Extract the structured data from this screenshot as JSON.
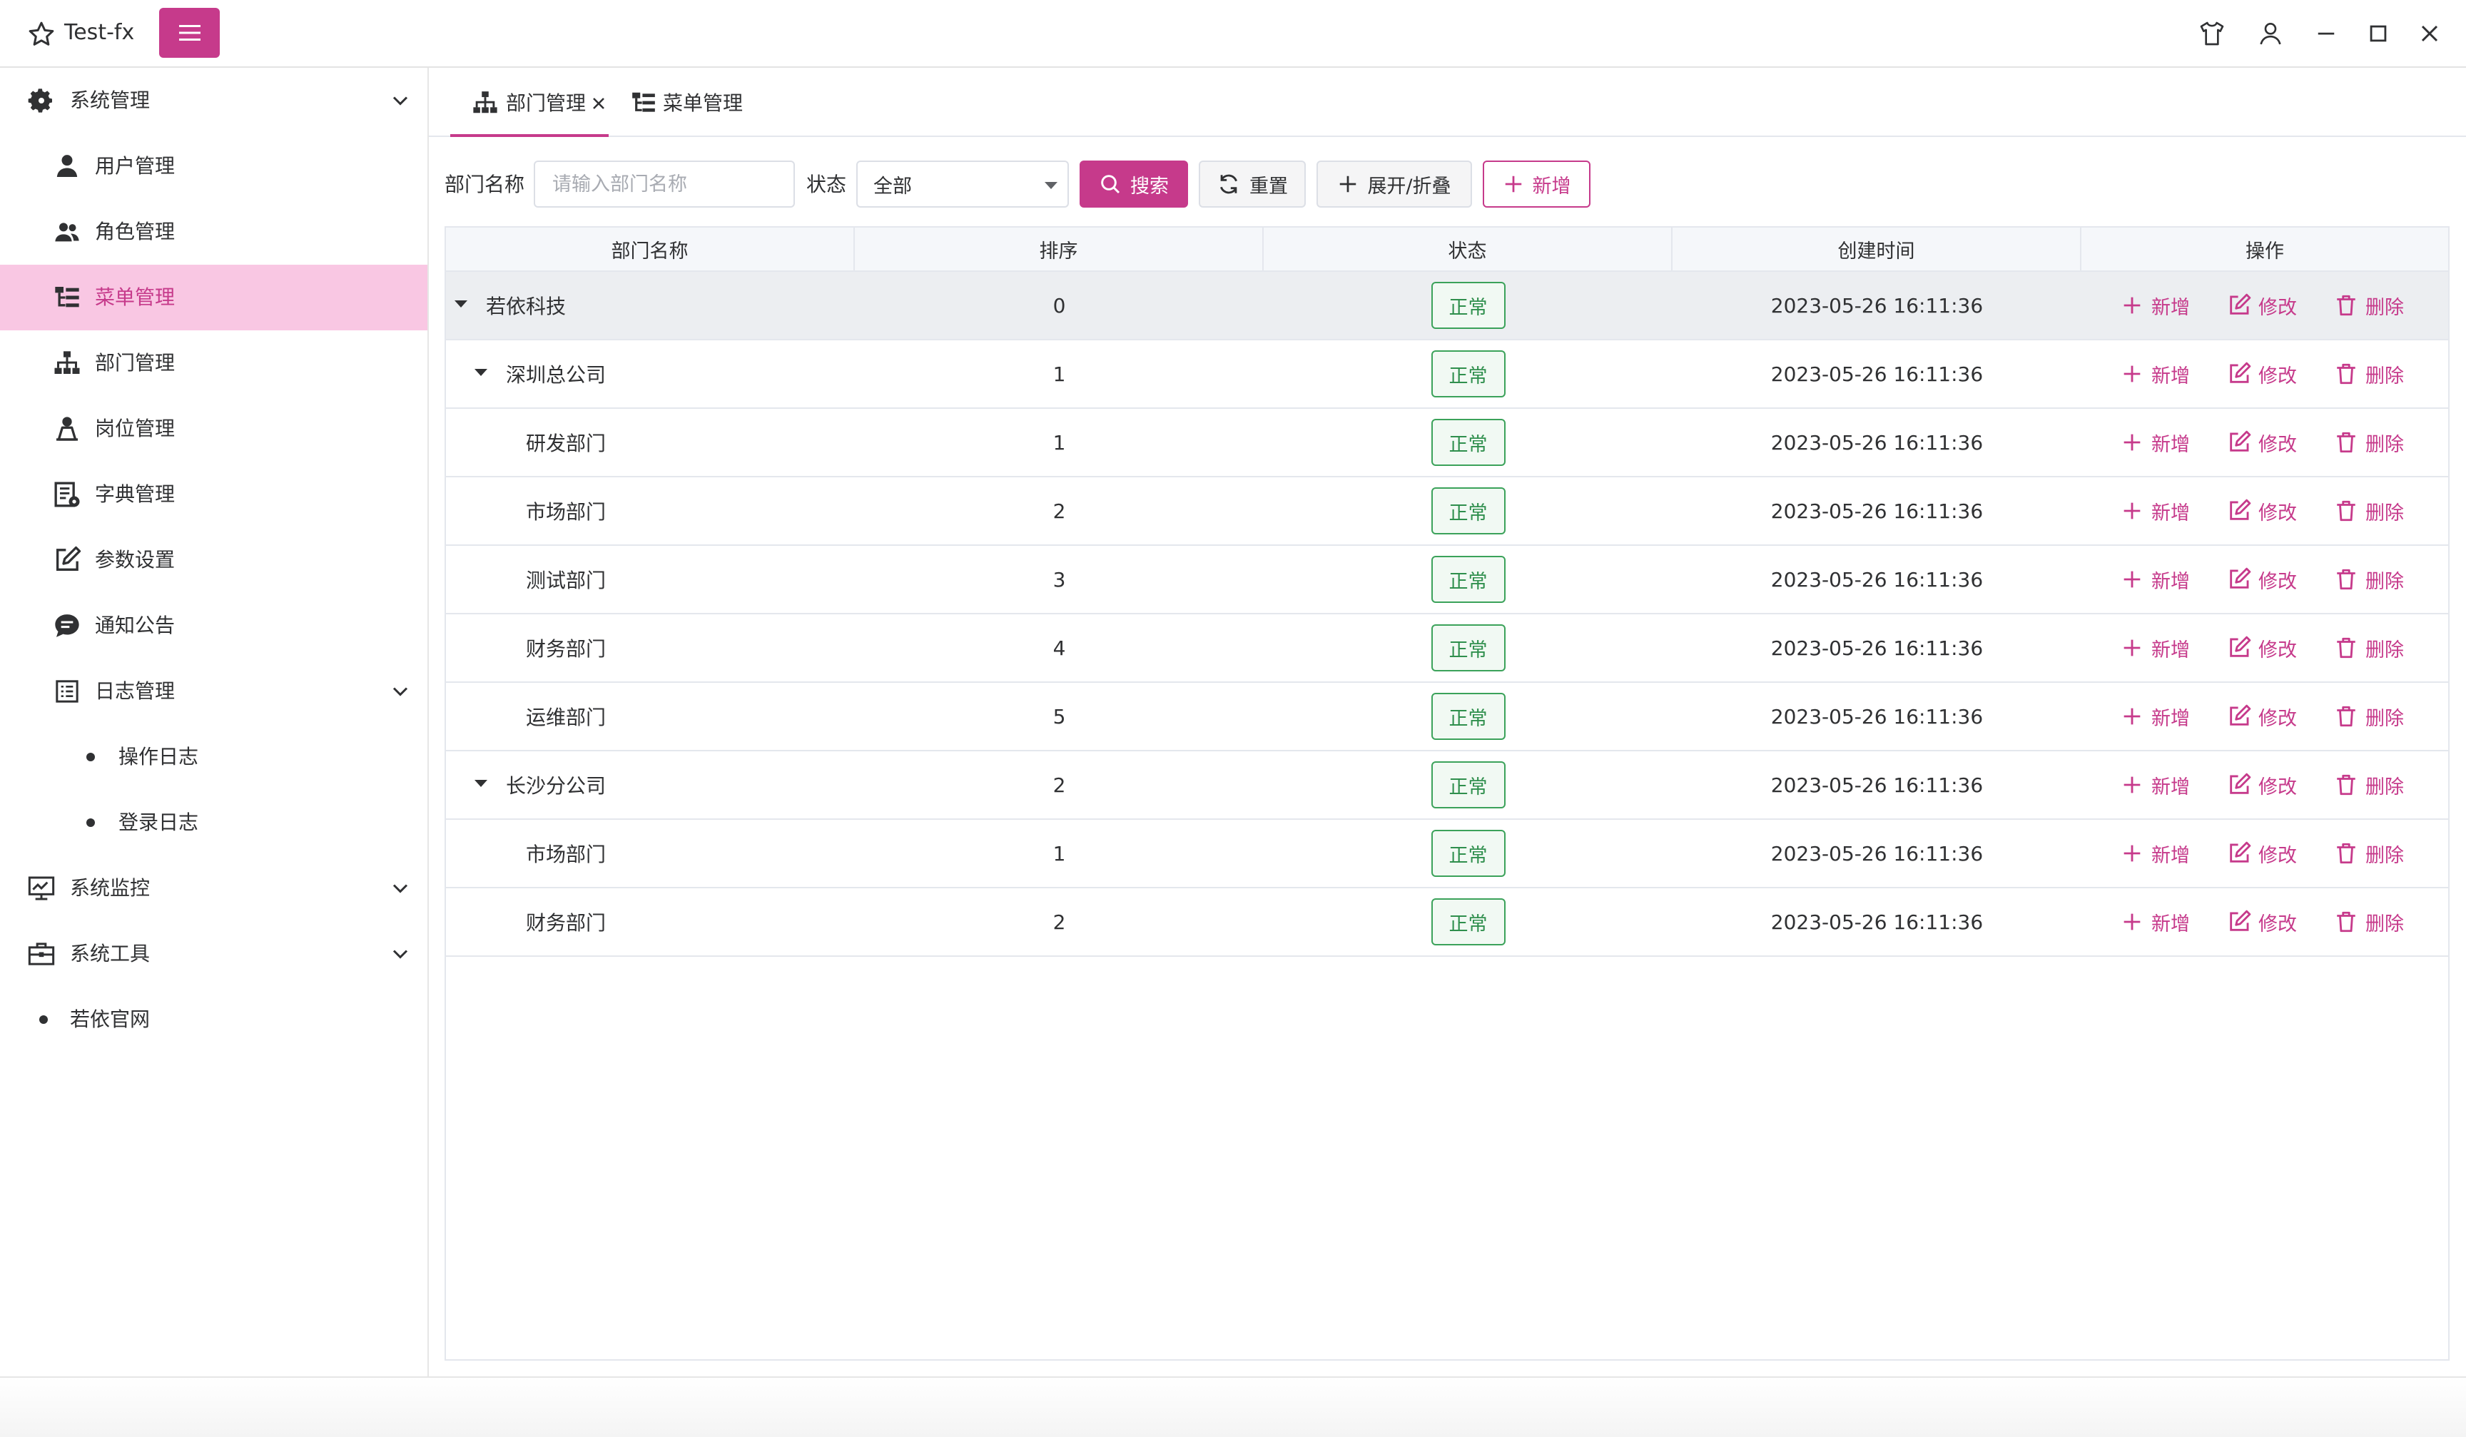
{
  "app": {
    "title": "Test-fx"
  },
  "colors": {
    "accent": "#c63a8b",
    "active_bg": "#f9c7e3",
    "status_green": "#3ba25a"
  },
  "sidebar": {
    "items": [
      {
        "label": "系统管理",
        "icon": "gear-icon",
        "expanded": true
      },
      {
        "label": "用户管理",
        "icon": "user-icon"
      },
      {
        "label": "角色管理",
        "icon": "users-icon"
      },
      {
        "label": "菜单管理",
        "icon": "tree-list-icon",
        "active": true
      },
      {
        "label": "部门管理",
        "icon": "org-chart-icon"
      },
      {
        "label": "岗位管理",
        "icon": "person-post-icon"
      },
      {
        "label": "字典管理",
        "icon": "dictionary-icon"
      },
      {
        "label": "参数设置",
        "icon": "edit-icon"
      },
      {
        "label": "通知公告",
        "icon": "chat-icon"
      },
      {
        "label": "日志管理",
        "icon": "log-icon",
        "expanded": true
      },
      {
        "label": "操作日志",
        "icon": "dot"
      },
      {
        "label": "登录日志",
        "icon": "dot"
      },
      {
        "label": "系统监控",
        "icon": "monitor-icon",
        "expanded": false
      },
      {
        "label": "系统工具",
        "icon": "toolbox-icon",
        "expanded": false
      },
      {
        "label": "若依官网",
        "icon": "dot"
      }
    ]
  },
  "tabs": [
    {
      "label": "部门管理",
      "icon": "org-chart-icon",
      "active": true,
      "closable": true
    },
    {
      "label": "菜单管理",
      "icon": "tree-list-icon",
      "active": false
    }
  ],
  "filters": {
    "dept_label": "部门名称",
    "dept_placeholder": "请输入部门名称",
    "dept_value": "",
    "status_label": "状态",
    "status_value": "全部",
    "search_button": "搜索",
    "reset_button": "重置",
    "expand_button": "展开/折叠",
    "add_button": "新增"
  },
  "table": {
    "columns": [
      "部门名称",
      "排序",
      "状态",
      "创建时间",
      "操作"
    ],
    "actions": {
      "add": "新增",
      "edit": "修改",
      "delete": "删除"
    },
    "rows": [
      {
        "name": "若依科技",
        "order": "0",
        "status": "正常",
        "created": "2023-05-26 16:11:36",
        "level": 0,
        "expandable": true
      },
      {
        "name": "深圳总公司",
        "order": "1",
        "status": "正常",
        "created": "2023-05-26 16:11:36",
        "level": 1,
        "expandable": true
      },
      {
        "name": "研发部门",
        "order": "1",
        "status": "正常",
        "created": "2023-05-26 16:11:36",
        "level": 2,
        "expandable": false
      },
      {
        "name": "市场部门",
        "order": "2",
        "status": "正常",
        "created": "2023-05-26 16:11:36",
        "level": 2,
        "expandable": false
      },
      {
        "name": "测试部门",
        "order": "3",
        "status": "正常",
        "created": "2023-05-26 16:11:36",
        "level": 2,
        "expandable": false
      },
      {
        "name": "财务部门",
        "order": "4",
        "status": "正常",
        "created": "2023-05-26 16:11:36",
        "level": 2,
        "expandable": false
      },
      {
        "name": "运维部门",
        "order": "5",
        "status": "正常",
        "created": "2023-05-26 16:11:36",
        "level": 2,
        "expandable": false
      },
      {
        "name": "长沙分公司",
        "order": "2",
        "status": "正常",
        "created": "2023-05-26 16:11:36",
        "level": 1,
        "expandable": true
      },
      {
        "name": "市场部门",
        "order": "1",
        "status": "正常",
        "created": "2023-05-26 16:11:36",
        "level": 2,
        "expandable": false
      },
      {
        "name": "财务部门",
        "order": "2",
        "status": "正常",
        "created": "2023-05-26 16:11:36",
        "level": 2,
        "expandable": false
      }
    ]
  }
}
